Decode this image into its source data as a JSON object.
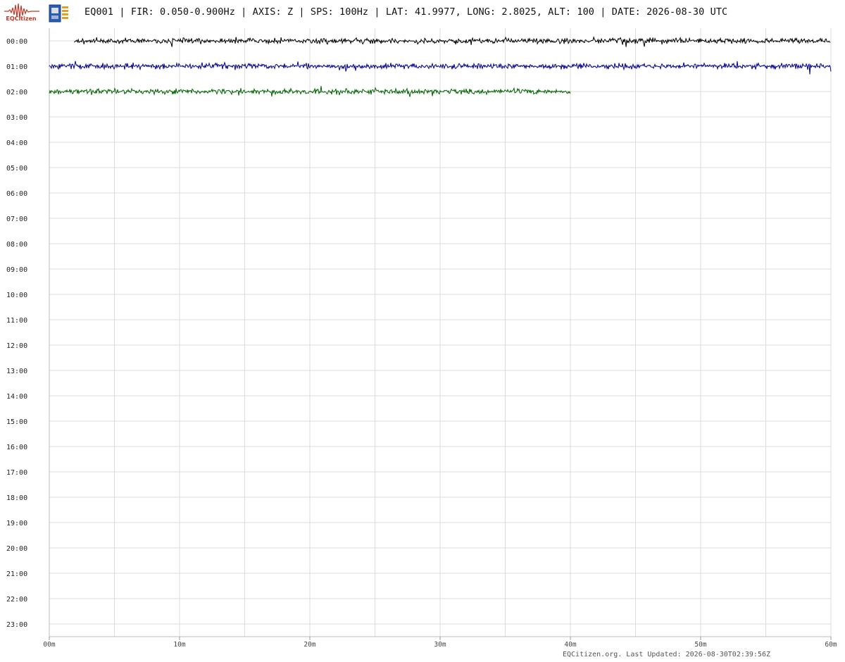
{
  "header": {
    "title": "EQ001 | FIR: 0.050-0.900Hz | AXIS: Z | SPS: 100Hz | LAT: 41.9977, LONG: 2.8025, ALT: 100 | DATE: 2026-08-30 UTC",
    "logo_text": "EQCitizen",
    "logo_icon": "seismograph-wave-icon",
    "device_icon": "sensor-board-icon"
  },
  "footer": {
    "text": "EQCitizen.org. Last Updated: 2026-08-30T02:39:56Z"
  },
  "chart_data": {
    "type": "line",
    "title": "",
    "xlabel": "",
    "ylabel": "",
    "x_ticks": [
      "00m",
      "10m",
      "20m",
      "30m",
      "40m",
      "50m",
      "60m"
    ],
    "x_range_minutes": [
      0,
      60
    ],
    "y_hours": [
      "00:00",
      "01:00",
      "02:00",
      "03:00",
      "04:00",
      "05:00",
      "06:00",
      "07:00",
      "08:00",
      "09:00",
      "10:00",
      "11:00",
      "12:00",
      "13:00",
      "14:00",
      "15:00",
      "16:00",
      "17:00",
      "18:00",
      "19:00",
      "20:00",
      "21:00",
      "22:00",
      "23:00"
    ],
    "grid": true,
    "minor_vertical_grid_minutes": 5,
    "traces": [
      {
        "hour": "00:00",
        "start_minute": 1.9,
        "end_minute": 60,
        "color": "#000000"
      },
      {
        "hour": "01:00",
        "start_minute": 0,
        "end_minute": 60,
        "color": "#00008b"
      },
      {
        "hour": "02:00",
        "start_minute": 0,
        "end_minute": 40,
        "color": "#006400"
      }
    ]
  }
}
